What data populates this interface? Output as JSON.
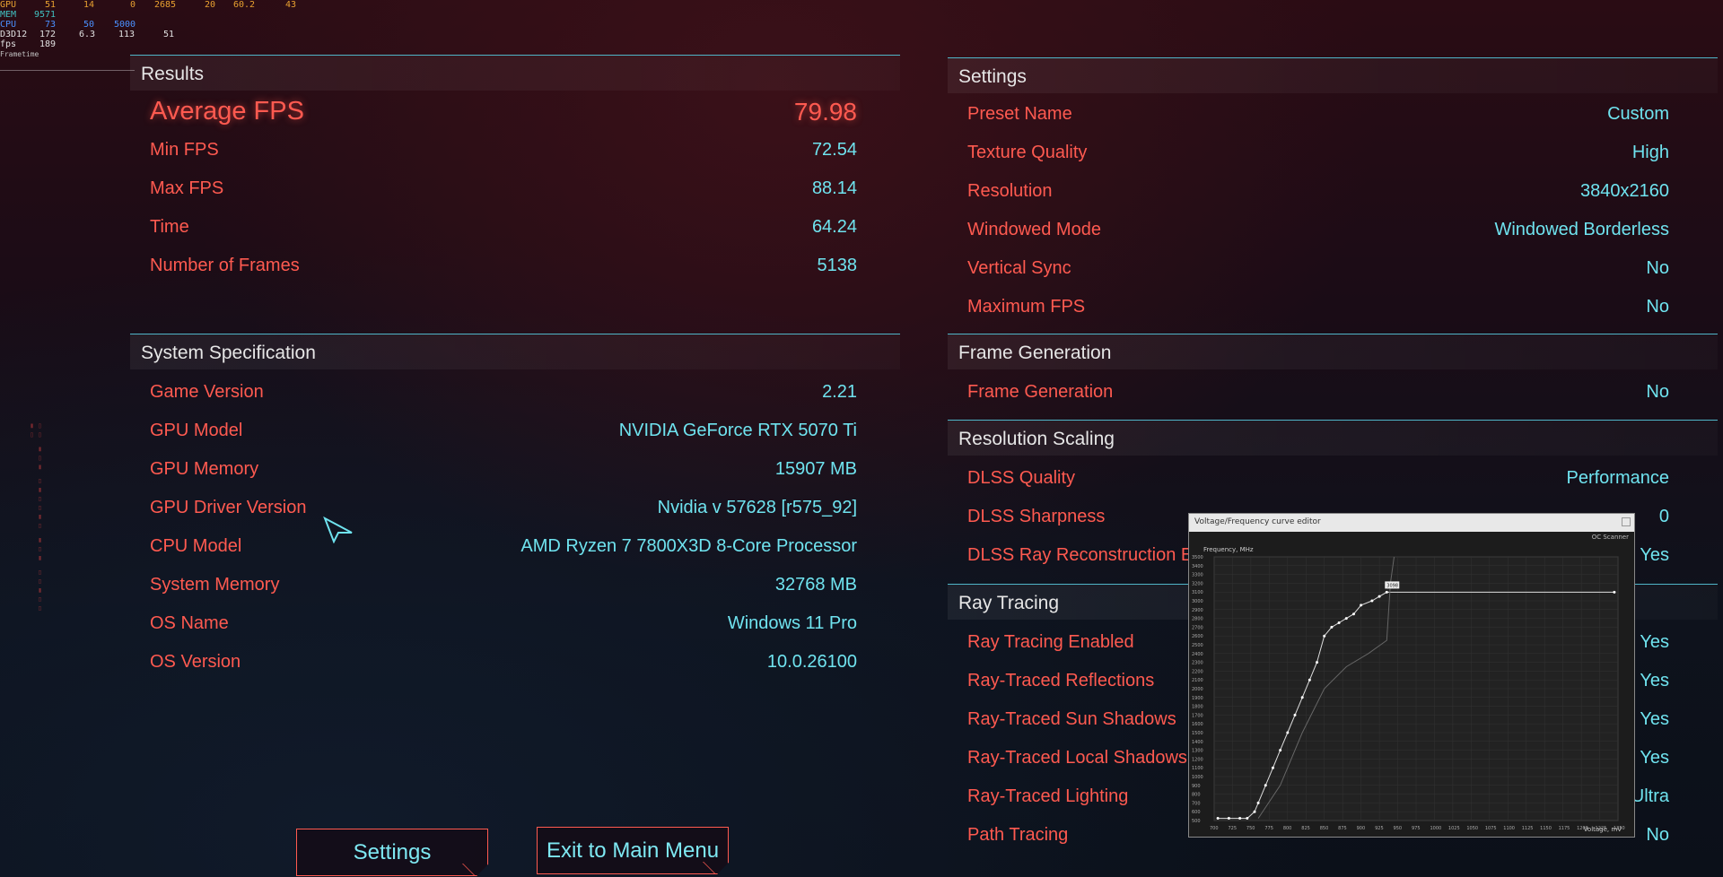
{
  "overlay": {
    "rows": [
      {
        "label": "GPU",
        "v1": "51",
        "v2": "14",
        "v3": "0",
        "v4": "2685",
        "v5": "20",
        "v6": "60.2",
        "v7": "43"
      },
      {
        "label": "MEM",
        "v1": "9571"
      },
      {
        "label": "CPU",
        "v1": "73",
        "v2": "50",
        "v3": "5000"
      },
      {
        "label": "D3D12",
        "v1": "172",
        "v2": "6.3",
        "v3": "113",
        "v4": "51"
      },
      {
        "label": "fps",
        "v1": "189"
      }
    ],
    "frametime": "Frametime"
  },
  "results": {
    "title": "Results",
    "average_label": "Average FPS",
    "average_value": "79.98",
    "rows": [
      {
        "label": "Min FPS",
        "value": "72.54"
      },
      {
        "label": "Max FPS",
        "value": "88.14"
      },
      {
        "label": "Time",
        "value": "64.24"
      },
      {
        "label": "Number of Frames",
        "value": "5138"
      }
    ]
  },
  "system": {
    "title": "System Specification",
    "rows": [
      {
        "label": "Game Version",
        "value": "2.21"
      },
      {
        "label": "GPU Model",
        "value": "NVIDIA GeForce RTX 5070 Ti"
      },
      {
        "label": "GPU Memory",
        "value": "15907 MB"
      },
      {
        "label": "GPU Driver Version",
        "value": "Nvidia v 57628 [r575_92]"
      },
      {
        "label": "CPU Model",
        "value": "AMD Ryzen 7 7800X3D 8-Core Processor"
      },
      {
        "label": "System Memory",
        "value": "32768 MB"
      },
      {
        "label": "OS Name",
        "value": "Windows 11 Pro"
      },
      {
        "label": "OS Version",
        "value": "10.0.26100"
      }
    ]
  },
  "settings": {
    "title": "Settings",
    "rows": [
      {
        "label": "Preset Name",
        "value": "Custom"
      },
      {
        "label": "Texture Quality",
        "value": "High"
      },
      {
        "label": "Resolution",
        "value": "3840x2160"
      },
      {
        "label": "Windowed Mode",
        "value": "Windowed Borderless"
      },
      {
        "label": "Vertical Sync",
        "value": "No"
      },
      {
        "label": "Maximum FPS",
        "value": "No"
      }
    ]
  },
  "frame_generation": {
    "title": "Frame Generation",
    "rows": [
      {
        "label": "Frame Generation",
        "value": "No"
      }
    ]
  },
  "resolution_scaling": {
    "title": "Resolution Scaling",
    "rows": [
      {
        "label": "DLSS Quality",
        "value": "Performance"
      },
      {
        "label": "DLSS Sharpness",
        "value": "0"
      },
      {
        "label": "DLSS Ray Reconstruction E",
        "value": "Yes"
      }
    ]
  },
  "ray_tracing": {
    "title": "Ray Tracing",
    "rows": [
      {
        "label": "Ray Tracing Enabled",
        "value": "Yes"
      },
      {
        "label": "Ray-Traced Reflections",
        "value": "Yes"
      },
      {
        "label": "Ray-Traced Sun Shadows",
        "value": "Yes"
      },
      {
        "label": "Ray-Traced Local Shadows",
        "value": "Yes"
      },
      {
        "label": "Ray-Traced Lighting",
        "value": "Ultra"
      },
      {
        "label": "Path Tracing",
        "value": "No"
      }
    ]
  },
  "buttons": {
    "settings": "Settings",
    "exit": "Exit to Main Menu"
  },
  "vf_editor": {
    "title": "Voltage/Frequency curve editor",
    "scanner": "OC Scanner",
    "ylabel": "Frequency, MHz",
    "xlabel": "Voltage, mV",
    "marker": "3098",
    "y_ticks": [
      "3500",
      "3400",
      "3300",
      "3200",
      "3100",
      "3000",
      "2900",
      "2800",
      "2700",
      "2600",
      "2500",
      "2400",
      "2300",
      "2200",
      "2100",
      "2000",
      "1900",
      "1800",
      "1700",
      "1600",
      "1500",
      "1400",
      "1300",
      "1200",
      "1100",
      "1000",
      "900",
      "800",
      "700",
      "600",
      "500"
    ],
    "x_ticks": [
      "700",
      "725",
      "750",
      "775",
      "800",
      "825",
      "850",
      "875",
      "900",
      "925",
      "950",
      "975",
      "1000",
      "1025",
      "1050",
      "1075",
      "1100",
      "1125",
      "1150",
      "1175",
      "1200",
      "1225",
      "1250"
    ]
  },
  "colors": {
    "label": "#ff5a50",
    "value": "#6fe3ef",
    "accent_line": "#4fb5c8"
  }
}
